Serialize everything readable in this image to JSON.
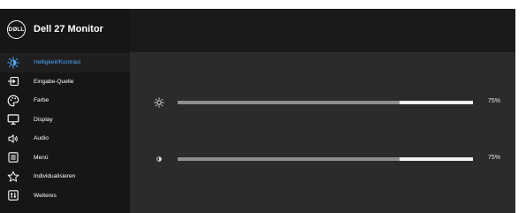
{
  "header": {
    "title": "Dell 27 Monitor",
    "logo_text": "DØLL"
  },
  "menu": {
    "items": [
      {
        "label": "Helligkeit/Kontrast",
        "icon": "brightness-contrast-icon",
        "active": true
      },
      {
        "label": "Eingabe-Quelle",
        "icon": "input-source-icon"
      },
      {
        "label": "Farbe",
        "icon": "color-palette-icon"
      },
      {
        "label": "Display",
        "icon": "display-icon"
      },
      {
        "label": "Audio",
        "icon": "audio-icon"
      },
      {
        "label": "Menü",
        "icon": "menu-icon"
      },
      {
        "label": "Individualisieren",
        "icon": "star-icon"
      },
      {
        "label": "Weiteres",
        "icon": "others-icon"
      }
    ]
  },
  "settings": {
    "brightness": {
      "value": 75,
      "label": "75%",
      "icon": "brightness-icon"
    },
    "contrast": {
      "value": 75,
      "label": "75%",
      "icon": "contrast-icon"
    }
  },
  "colors": {
    "active_text": "#4aa8ff",
    "track": "#f2f2f2",
    "fill": "#8e8e8e"
  }
}
